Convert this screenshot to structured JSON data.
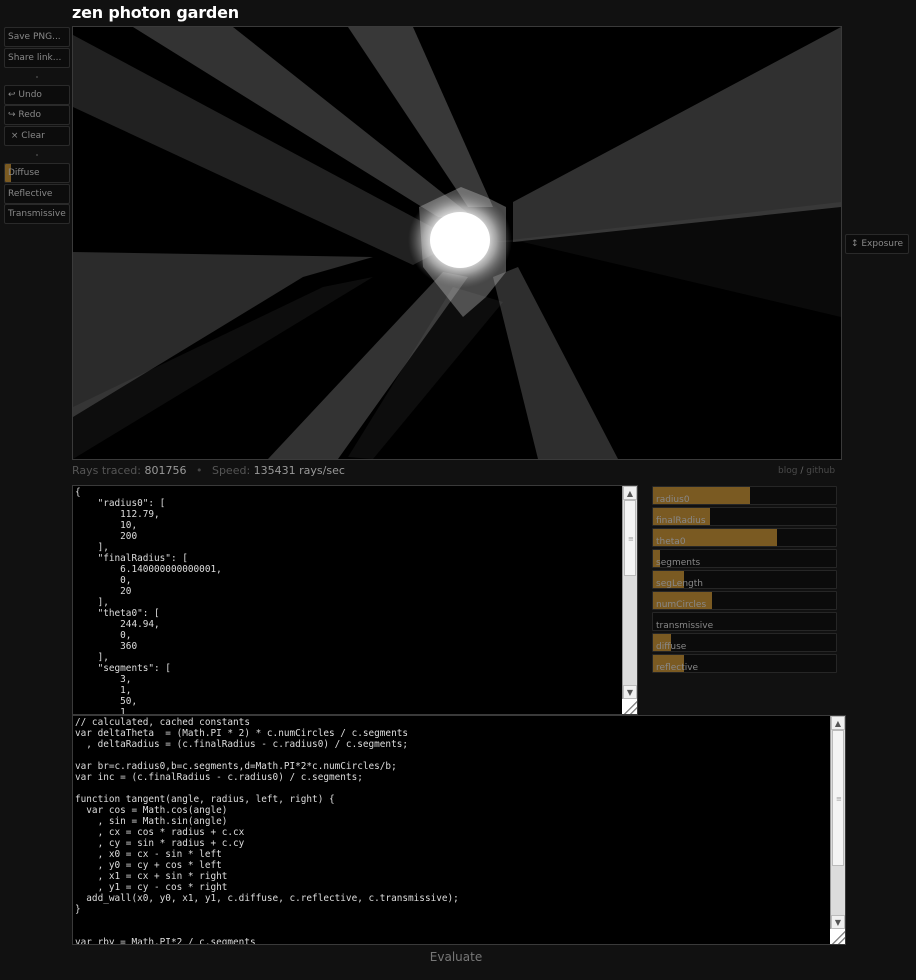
{
  "app": {
    "title": "zen photon garden"
  },
  "toolbar": {
    "save_png": "Save PNG...",
    "share_link": "Share link...",
    "undo": {
      "icon": "undo-arrow-icon",
      "glyph": "↩",
      "label": "Undo"
    },
    "redo": {
      "icon": "redo-arrow-icon",
      "glyph": "↪",
      "label": "Redo"
    },
    "clear": {
      "icon": "close-x-icon",
      "glyph": "×",
      "label": "Clear"
    },
    "materials": [
      {
        "label": "Diffuse",
        "value": 0.1
      },
      {
        "label": "Reflective",
        "value": 0
      },
      {
        "label": "Transmissive",
        "value": 0
      }
    ]
  },
  "exposure": {
    "icon": "vertical-resize-icon",
    "glyph": "↕",
    "label": "Exposure"
  },
  "stats": {
    "rays_label": "Rays traced:",
    "rays_value": "801756",
    "separator": "•",
    "speed_label": "Speed:",
    "speed_value": "135431 rays/sec"
  },
  "links": {
    "blog": "blog",
    "slash": "/",
    "github": "github"
  },
  "json_editor": {
    "text": "{\n    \"radius0\": [\n        112.79,\n        10,\n        200\n    ],\n    \"finalRadius\": [\n        6.140000000000001,\n        0,\n        20\n    ],\n    \"theta0\": [\n        244.94,\n        0,\n        360\n    ],\n    \"segments\": [\n        3,\n        1,\n        50,\n        1"
  },
  "code_editor": {
    "text": "// calculated, cached constants\nvar deltaTheta  = (Math.PI * 2) * c.numCircles / c.segments\n  , deltaRadius = (c.finalRadius - c.radius0) / c.segments;\n\nvar br=c.radius0,b=c.segments,d=Math.PI*2*c.numCircles/b;\nvar inc = (c.finalRadius - c.radius0) / c.segments;\n\nfunction tangent(angle, radius, left, right) {\n  var cos = Math.cos(angle)\n    , sin = Math.sin(angle)\n    , cx = cos * radius + c.cx\n    , cy = sin * radius + c.cy\n    , x0 = cx - sin * left\n    , y0 = cy + cos * left\n    , x1 = cx + sin * right\n    , y1 = cy - cos * right\n  add_wall(x0, y0, x1, y1, c.diffuse, c.reflective, c.transmissive);\n}\n\n\nvar rby = Math.PI*2 / c.segments"
  },
  "parameters": [
    {
      "name": "radius0",
      "fraction": 0.53
    },
    {
      "name": "finalRadius",
      "fraction": 0.31
    },
    {
      "name": "theta0",
      "fraction": 0.68
    },
    {
      "name": "segments",
      "fraction": 0.04
    },
    {
      "name": "segLength",
      "fraction": 0.17
    },
    {
      "name": "numCircles",
      "fraction": 0.32
    },
    {
      "name": "transmissive",
      "fraction": 0.0
    },
    {
      "name": "diffuse",
      "fraction": 0.1
    },
    {
      "name": "reflective",
      "fraction": 0.17
    }
  ],
  "evaluate_label": "Evaluate"
}
